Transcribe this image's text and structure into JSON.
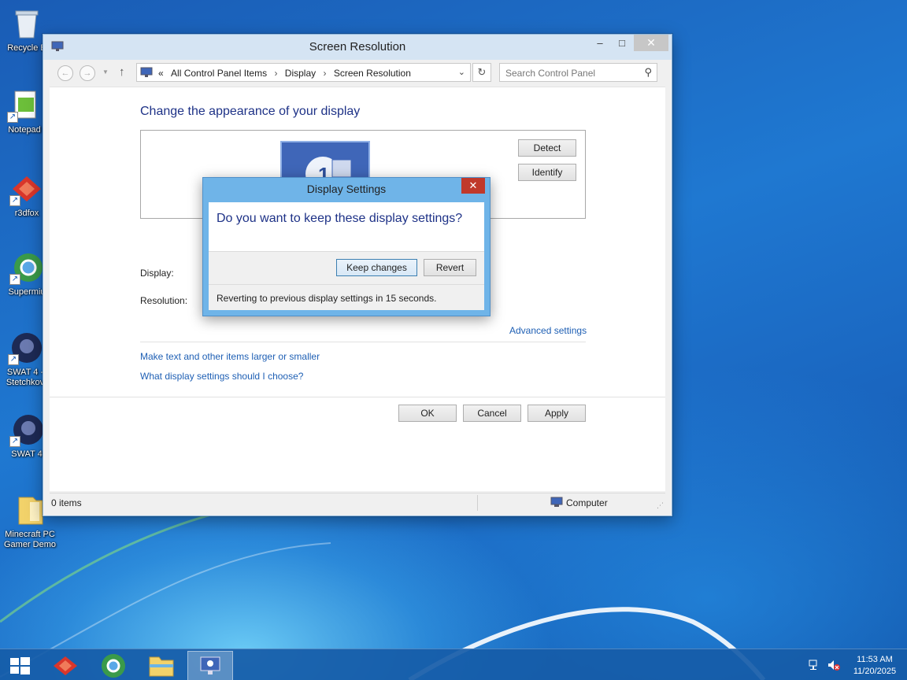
{
  "desktop": {
    "icons": [
      {
        "label": "Recycle B",
        "icon": "recycle-bin-icon"
      },
      {
        "label": "Notepad",
        "icon": "notepad-icon"
      },
      {
        "label": "r3dfox",
        "icon": "r3dfox-icon"
      },
      {
        "label": "Supermiu",
        "icon": "browser-icon"
      },
      {
        "label": "SWAT 4 - Stetchkov",
        "icon": "swat-icon"
      },
      {
        "label": "SWAT 4",
        "icon": "swat-icon"
      },
      {
        "label": "Minecraft PC Gamer Demo",
        "icon": "folder-icon"
      }
    ]
  },
  "window": {
    "title": "Screen Resolution",
    "controls": {
      "minimize": "‒",
      "maximize": "□",
      "close": "✕"
    },
    "address": {
      "prefix": "«",
      "crumbs": [
        "All Control Panel Items",
        "Display",
        "Screen Resolution"
      ]
    },
    "search_placeholder": "Search Control Panel",
    "heading": "Change the appearance of your display",
    "monitor_number": "1",
    "detect_label": "Detect",
    "identify_label": "Identify",
    "display_label": "Display:",
    "resolution_label": "Resolution:",
    "advanced_link": "Advanced settings",
    "text_size_link": "Make text and other items larger or smaller",
    "help_link": "What display settings should I choose?",
    "ok_label": "OK",
    "cancel_label": "Cancel",
    "apply_label": "Apply",
    "status_items": "0 items",
    "status_location": "Computer"
  },
  "dialog": {
    "title": "Display Settings",
    "close": "✕",
    "question": "Do you want to keep these display settings?",
    "keep_label": "Keep changes",
    "revert_label": "Revert",
    "countdown_text": "Reverting to previous display settings in 15 seconds."
  },
  "taskbar": {
    "items": [
      "start-button",
      "r3dfox",
      "browser",
      "file-explorer",
      "control-panel"
    ],
    "active_item": "control-panel",
    "clock_time": "11:53 AM",
    "clock_date": "11/20/2025"
  },
  "colors": {
    "accent": "#1e3287",
    "link": "#1e5fb4",
    "dialog_frame": "#6fb4e8",
    "close_red": "#c0392b"
  }
}
